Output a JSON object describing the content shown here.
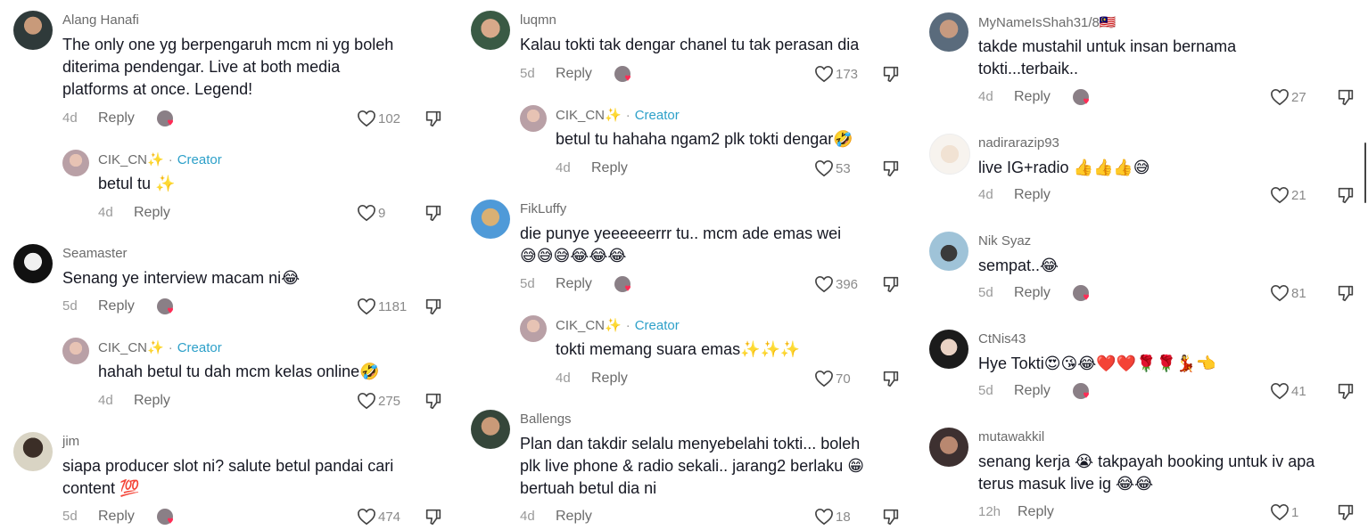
{
  "reply_label": "Reply",
  "creator_label": "Creator",
  "dot": "·",
  "columns": [
    {
      "comments": [
        {
          "user": "Alang Hanafi",
          "lines": [
            "The only one yg berpengaruh mcm ni yg boleh",
            "diterima pendengar. Live at both media",
            "platforms at once. Legend!"
          ],
          "time": "4d",
          "likes": "102"
        },
        {
          "user": "CIK_CN✨",
          "creator": true,
          "lines": [
            "betul tu ✨"
          ],
          "time": "4d",
          "likes": "9"
        },
        {
          "user": "Seamaster",
          "lines": [
            "Senang ye interview macam ni😂"
          ],
          "time": "5d",
          "likes": "1181"
        },
        {
          "user": "CIK_CN✨",
          "creator": true,
          "lines": [
            "hahah betul tu dah mcm kelas online🤣"
          ],
          "time": "4d",
          "likes": "275"
        },
        {
          "user": "jim",
          "lines": [
            "siapa producer slot ni? salute betul pandai cari",
            "content 💯"
          ],
          "time": "5d",
          "likes": "474"
        }
      ]
    },
    {
      "comments": [
        {
          "user": "luqmn",
          "lines": [
            "Kalau tokti tak dengar chanel tu tak perasan dia"
          ],
          "time": "5d",
          "likes": "173"
        },
        {
          "user": "CIK_CN✨",
          "creator": true,
          "lines": [
            "betul tu hahaha ngam2 plk tokti dengar🤣"
          ],
          "time": "4d",
          "likes": "53"
        },
        {
          "user": "FikLuffy",
          "lines": [
            "die punye yeeeeeerrr tu.. mcm ade emas wei",
            "😅😅😅😂😂😂"
          ],
          "time": "5d",
          "likes": "396"
        },
        {
          "user": "CIK_CN✨",
          "creator": true,
          "lines": [
            "tokti memang suara emas✨✨✨"
          ],
          "time": "4d",
          "likes": "70"
        },
        {
          "user": "Ballengs",
          "lines": [
            "Plan dan takdir selalu menyebelahi tokti... boleh",
            "plk live phone & radio sekali.. jarang2 berlaku 😁",
            "bertuah betul dia ni"
          ],
          "time": "4d",
          "likes": "18"
        }
      ]
    },
    {
      "comments": [
        {
          "user": "MyNameIsShah31/8🇲🇾",
          "lines": [
            "takde mustahil untuk insan bernama",
            "tokti...terbaik.."
          ],
          "time": "4d",
          "likes": "27"
        },
        {
          "user": "nadirarazip93",
          "lines": [
            "live IG+radio 👍👍👍😅"
          ],
          "time": "4d",
          "likes": "21"
        },
        {
          "user": "Nik Syaz",
          "lines": [
            "sempat..😂"
          ],
          "time": "5d",
          "likes": "81"
        },
        {
          "user": "CtNis43",
          "lines": [
            "Hye Tokti😍😘😂❤️❤️🌹🌹💃👈"
          ],
          "time": "5d",
          "likes": "41"
        },
        {
          "user": "mutawakkil",
          "lines": [
            "senang kerja 😭 takpayah booking untuk iv apa",
            "terus masuk live ig 😂😂"
          ],
          "time": "12h",
          "likes": "1"
        }
      ]
    }
  ]
}
